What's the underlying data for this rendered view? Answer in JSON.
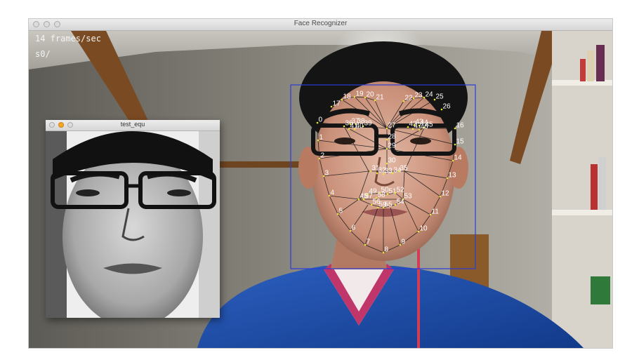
{
  "main_window": {
    "title": "Face Recognizer",
    "fps_text": "14 frames/sec",
    "subject_label": "s0/"
  },
  "sub_window": {
    "title": "test_equ"
  },
  "landmarks": [
    "0",
    "1",
    "2",
    "3",
    "4",
    "5",
    "6",
    "7",
    "8",
    "9",
    "10",
    "11",
    "12",
    "13",
    "14",
    "15",
    "16",
    "17",
    "18",
    "19",
    "20",
    "21",
    "22",
    "23",
    "24",
    "25",
    "26",
    "27",
    "28",
    "29",
    "30",
    "31",
    "32",
    "33",
    "34",
    "35",
    "36",
    "37",
    "38",
    "39",
    "40",
    "41",
    "42",
    "43",
    "44",
    "45",
    "46",
    "47",
    "48",
    "49",
    "50",
    "51",
    "52",
    "53",
    "54",
    "55",
    "56",
    "57",
    "58",
    "59"
  ],
  "colors": {
    "bounding_box": "#2b3cd8",
    "landmark_text": "#ffffff",
    "landmark_point": "#e6e63a",
    "mesh_line": "#1a1a1a"
  }
}
